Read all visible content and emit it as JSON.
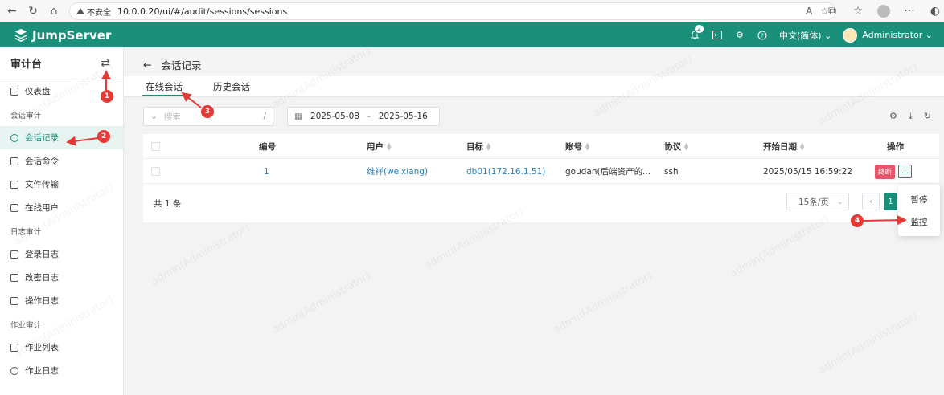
{
  "browser": {
    "not_secure": "不安全",
    "url": "10.0.0.20/ui/#/audit/sessions/sessions"
  },
  "topbar": {
    "brand": "JumpServer",
    "notification_count": "2",
    "language": "中文(简体)",
    "user": "Administrator"
  },
  "sidebar": {
    "title": "审计台",
    "items": [
      {
        "label": "仪表盘",
        "type": "item"
      },
      {
        "label": "会话审计",
        "type": "group"
      },
      {
        "label": "会话记录",
        "type": "item",
        "active": true
      },
      {
        "label": "会话命令",
        "type": "item"
      },
      {
        "label": "文件传输",
        "type": "item"
      },
      {
        "label": "在线用户",
        "type": "item"
      },
      {
        "label": "日志审计",
        "type": "group"
      },
      {
        "label": "登录日志",
        "type": "item"
      },
      {
        "label": "改密日志",
        "type": "item"
      },
      {
        "label": "操作日志",
        "type": "item"
      },
      {
        "label": "作业审计",
        "type": "group"
      },
      {
        "label": "作业列表",
        "type": "item"
      },
      {
        "label": "作业日志",
        "type": "item"
      }
    ]
  },
  "page": {
    "title": "会话记录",
    "tabs": [
      "在线会话",
      "历史会话"
    ],
    "search_placeholder": "搜索",
    "search_shortcut": "/",
    "date_start": "2025-05-08",
    "date_sep": "-",
    "date_end": "2025-05-16"
  },
  "table": {
    "headers": [
      "编号",
      "用户",
      "目标",
      "账号",
      "协议",
      "开始日期",
      "操作"
    ],
    "rows": [
      {
        "id": "1",
        "user": "维祥(weixiang)",
        "target": "db01(172.16.1.51)",
        "account": "goudan(后端资产的...",
        "protocol": "ssh",
        "start": "2025/05/15 16:59:22"
      }
    ],
    "terminate_label": "终断",
    "more_label": "...",
    "total": "共 1 条",
    "page_size": "15条/页",
    "current_page": "1"
  },
  "dropdown": {
    "items": [
      "暂停",
      "监控"
    ]
  },
  "annotations": [
    "1",
    "2",
    "3",
    "4"
  ],
  "watermark": "admin(Administrator)"
}
